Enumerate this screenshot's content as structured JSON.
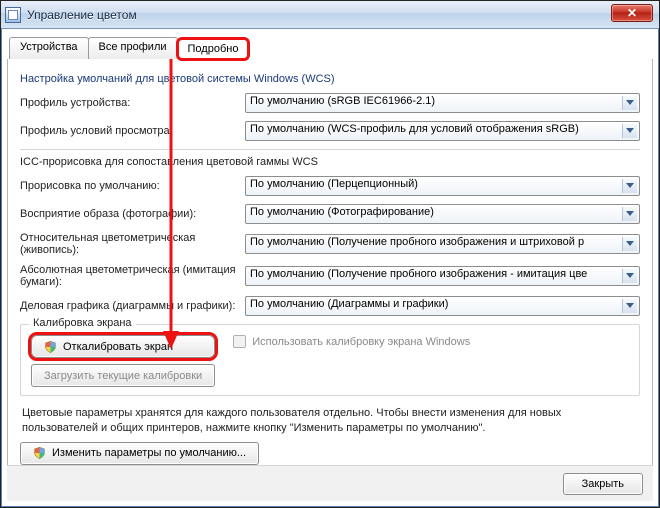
{
  "window": {
    "title": "Управление цветом"
  },
  "tabs": [
    {
      "id": "devices",
      "label": "Устройства"
    },
    {
      "id": "profiles",
      "label": "Все профили"
    },
    {
      "id": "advanced",
      "label": "Подробно"
    }
  ],
  "wcs_defaults": {
    "heading": "Настройка умолчаний для цветовой системы Windows (WCS)",
    "device_profile_label": "Профиль устройства:",
    "device_profile_value": "По умолчанию (sRGB IEC61966-2.1)",
    "viewing_profile_label": "Профиль условий просмотра:",
    "viewing_profile_value": "По умолчанию (WCS-профиль для условий отображения sRGB)"
  },
  "icc": {
    "heading": "ICC-прорисовка для сопоставления цветовой гаммы WCS",
    "default_intent_label": "Прорисовка по умолчанию:",
    "default_intent_value": "По умолчанию (Перцепционный)",
    "perceptual_label": "Восприятие образа (фотографии):",
    "perceptual_value": "По умолчанию (Фотографирование)",
    "rel_label": "Относительная цветометрическая (живопись):",
    "rel_value": "По умолчанию (Получение пробного изображения и штриховой р",
    "abs_label": "Абсолютная цветометрическая (имитация бумаги):",
    "abs_value": "По умолчанию (Получение пробного изображения - имитация цве",
    "biz_label": "Деловая графика (диаграммы и графики):",
    "biz_value": "По умолчанию (Диаграммы и графики)"
  },
  "calibration": {
    "legend": "Калибровка экрана",
    "calibrate_btn": "Откалибровать экран",
    "load_btn": "Загрузить текущие калибровки",
    "use_windows_cb": "Использовать калибровку экрана Windows"
  },
  "footnote": "Цветовые параметры хранятся для каждого пользователя отдельно. Чтобы внести изменения для новых пользователей и общих принтеров, нажмите кнопку \"Изменить параметры по умолчанию\".",
  "change_defaults_btn": "Изменить параметры по умолчанию...",
  "close_btn": "Закрыть",
  "highlight_color": "#e11"
}
